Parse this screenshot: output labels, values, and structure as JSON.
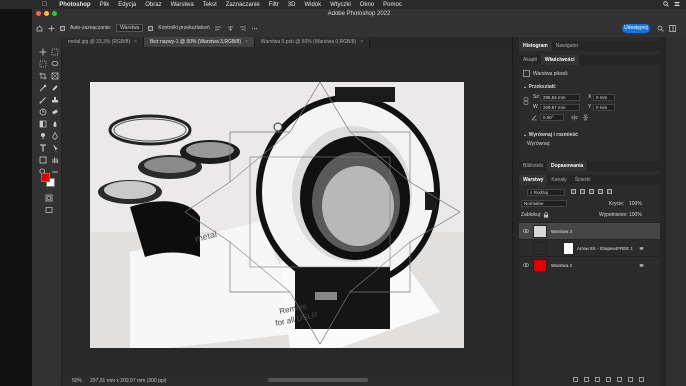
{
  "menubar": {
    "items": [
      "Photoshop",
      "Plik",
      "Edycja",
      "Obraz",
      "Warstwa",
      "Tekst",
      "Zaznaczanie",
      "Filtr",
      "3D",
      "Widok",
      "Wtyczki",
      "Okno",
      "Pomoc"
    ]
  },
  "window": {
    "title": "Adobe Photoshop 2022"
  },
  "options_bar": {
    "auto_select_label": "Auto-zaznaczanie:",
    "auto_select_value": "Warstwa",
    "transform_label": "Kontrolki przekształceń",
    "share_label": "Udostępnij"
  },
  "tabs": [
    {
      "label": "metal.jpg @ 33,3% (RGB/8)",
      "active": false
    },
    {
      "label": "Bez nazwy-1 @ 50% (Warstwa 3,RGB/8)",
      "active": true
    },
    {
      "label": "Warstwa 0.psb @ 50% (Warstwa 0,RGB/8)",
      "active": false
    }
  ],
  "status": {
    "zoom": "50%",
    "doc_size": "297,01 mm x 209,97 mm (300 ppi)"
  },
  "panels": {
    "top_tabs": [
      "Histogram",
      "Nawigator"
    ],
    "props_tabs": [
      "Akapit",
      "Właściwości"
    ],
    "props_kind": "Warstwa pikseli",
    "transform_title": "Przekształć",
    "w_label": "Sz",
    "w_value": "295,54 mm",
    "h_label": "W",
    "h_value": "209,97 mm",
    "x_label": "X",
    "x_value": "0 mm",
    "y_label": "Y",
    "y_value": "0 mm",
    "angle_value": "0,00°",
    "align_title": "Wyrównaj i rozmieść",
    "align_sub": "Wyrównaj:",
    "lib_tabs": [
      "Biblioteki",
      "Dopasowania"
    ],
    "layers_tabs": [
      "Warstwy",
      "Kanały",
      "Ścieżki"
    ],
    "filter_label": "Rodzaj",
    "blend_mode": "Normalne",
    "opacity_label": "Krycie:",
    "opacity_value": "100%",
    "lock_label": "Zablokuj:",
    "fill_label": "Wypełnienie:",
    "fill_value": "100%",
    "layers": [
      {
        "name": "Warstwa 3",
        "selected": true
      },
      {
        "name": "Arrow 8S - Shapes4FREE 1",
        "selected": false
      },
      {
        "name": "Warstwa 2",
        "selected": false
      }
    ]
  },
  "colors": {
    "accent": "#1473e6",
    "foreground_swatch": "#e00000",
    "background_swatch": "#ffffff"
  },
  "icons": [
    "move-tool-icon",
    "marquee-tool-icon",
    "lasso-tool-icon",
    "crop-tool-icon",
    "eyedropper-tool-icon",
    "healing-brush-icon",
    "brush-tool-icon",
    "stamp-tool-icon",
    "history-brush-icon",
    "eraser-tool-icon",
    "gradient-tool-icon",
    "blur-tool-icon",
    "dodge-tool-icon",
    "pen-tool-icon",
    "type-tool-icon",
    "path-select-icon",
    "shape-tool-icon",
    "hand-tool-icon",
    "zoom-tool-icon",
    "eye-icon",
    "lock-icon"
  ]
}
